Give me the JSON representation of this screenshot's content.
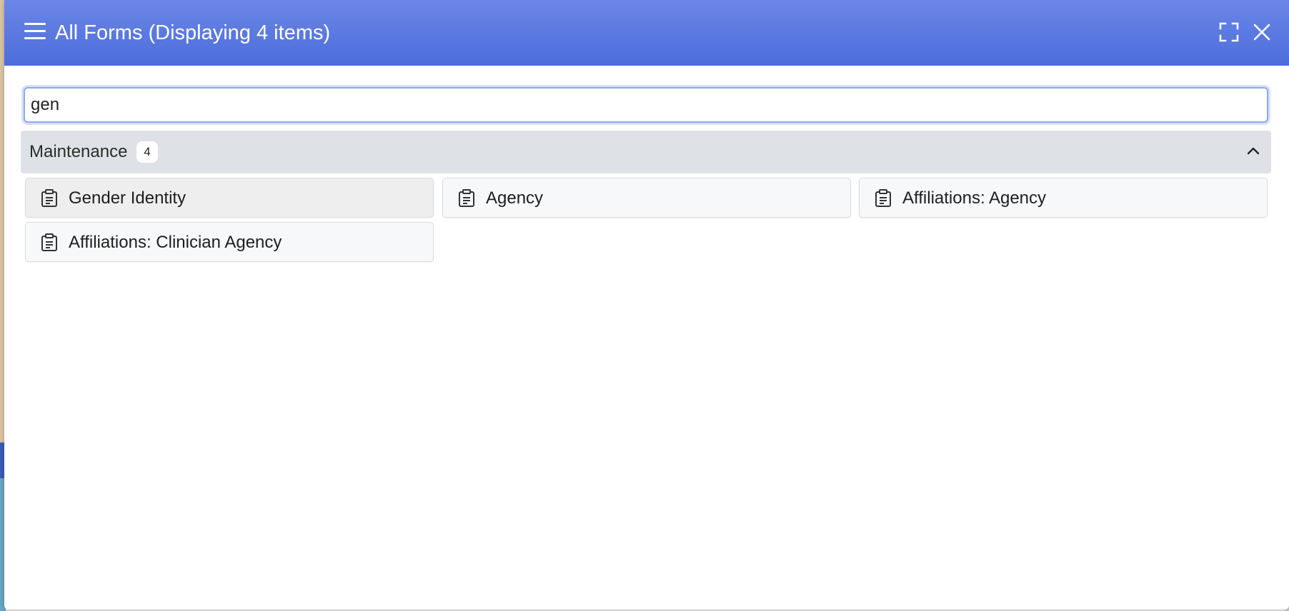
{
  "header": {
    "title": "All Forms (Displaying 4 items)",
    "menu_icon": "hamburger-menu-icon",
    "fullscreen_icon": "fullscreen-icon",
    "close_icon": "close-icon",
    "gradient_top": "#6b86e6",
    "gradient_bottom": "#4c6ddc"
  },
  "search": {
    "value": "gen",
    "placeholder": ""
  },
  "group": {
    "label": "Maintenance",
    "count": "4",
    "chevron_icon": "chevron-up-icon",
    "items": [
      {
        "label": "Gender Identity",
        "icon": "clipboard-icon"
      },
      {
        "label": "Agency",
        "icon": "clipboard-icon"
      },
      {
        "label": "Affiliations: Agency",
        "icon": "clipboard-icon"
      },
      {
        "label": "Affiliations: Clinician Agency",
        "icon": "clipboard-icon"
      }
    ]
  }
}
